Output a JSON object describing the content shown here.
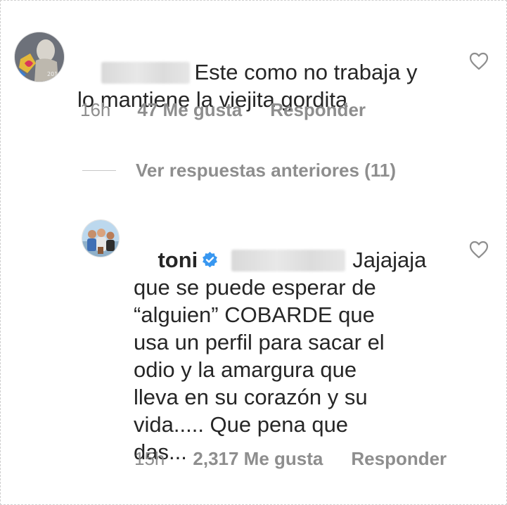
{
  "comment1": {
    "text": "Este como no trabaja y\nlo mantiene la viejita gordita",
    "time": "16h",
    "likes": "47 Me gusta",
    "reply_label": "Responder",
    "avatar_icon": "user-avatar-icon",
    "like_icon": "heart-outline-icon"
  },
  "replies": {
    "view_label": "Ver respuestas anteriores (11)"
  },
  "comment2": {
    "username": "toni",
    "text_line1": "Jajajaja",
    "text_rest": "que se puede esperar de\n“alguien” COBARDE que\nusa un perfil para sacar el\nodio y la amargura que\nlleva en su corazón y su\nvida..... Que pena que\ndas...",
    "time": "15h",
    "likes": "2,317 Me gusta",
    "reply_label": "Responder",
    "verified_icon": "verified-badge-icon",
    "avatar_icon": "user-avatar-icon",
    "like_icon": "heart-outline-icon",
    "accent_color": "#3897f0"
  },
  "colors": {
    "text": "#262626",
    "meta": "#8e8e8e",
    "verified": "#3897f0"
  }
}
